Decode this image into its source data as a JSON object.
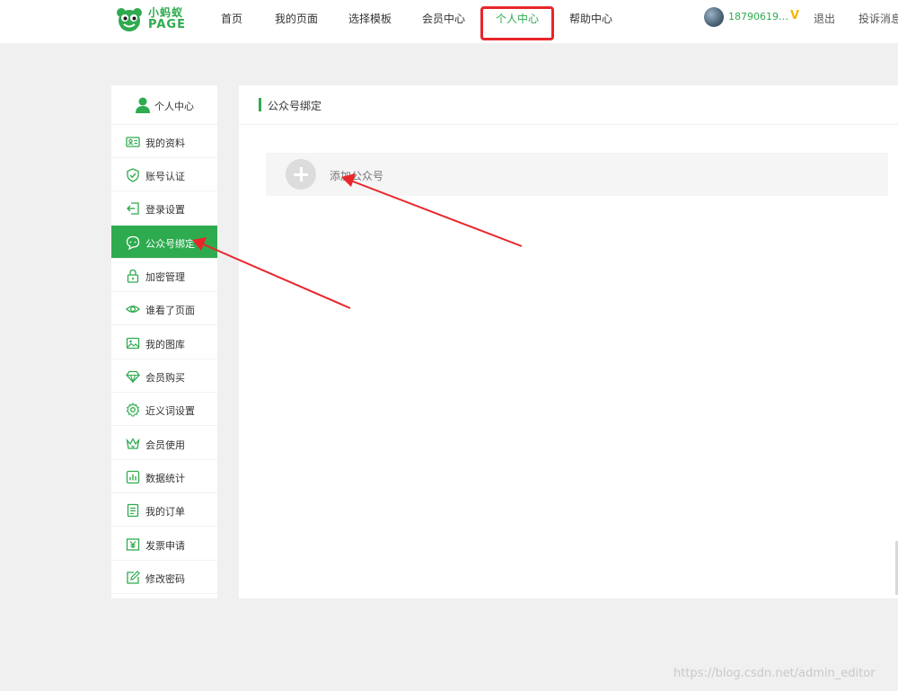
{
  "brand": {
    "name_cn": "小蚂蚁",
    "name_en": "PAGE",
    "color": "#2eab4f"
  },
  "nav": {
    "items": [
      {
        "label": "首页"
      },
      {
        "label": "我的页面"
      },
      {
        "label": "选择模板"
      },
      {
        "label": "会员中心"
      },
      {
        "label": "个人中心",
        "active": true
      },
      {
        "label": "帮助中心"
      }
    ]
  },
  "user": {
    "phone": "18790619…",
    "vip_badge": "V",
    "logout": "退出",
    "complain": "投诉消息"
  },
  "sidebar": {
    "header": "个人中心",
    "items": [
      {
        "label": "我的资料",
        "icon": "id-card-icon"
      },
      {
        "label": "账号认证",
        "icon": "shield-check-icon"
      },
      {
        "label": "登录设置",
        "icon": "login-icon"
      },
      {
        "label": "公众号绑定",
        "icon": "chat-bubble-icon",
        "active": true
      },
      {
        "label": "加密管理",
        "icon": "lock-icon"
      },
      {
        "label": "谁看了页面",
        "icon": "eye-icon"
      },
      {
        "label": "我的图库",
        "icon": "image-icon"
      },
      {
        "label": "会员购买",
        "icon": "diamond-icon"
      },
      {
        "label": "近义词设置",
        "icon": "gear-icon"
      },
      {
        "label": "会员使用",
        "icon": "crown-icon"
      },
      {
        "label": "数据统计",
        "icon": "bar-chart-icon"
      },
      {
        "label": "我的订单",
        "icon": "document-icon"
      },
      {
        "label": "发票申请",
        "icon": "yen-icon"
      },
      {
        "label": "修改密码",
        "icon": "edit-icon"
      }
    ]
  },
  "main": {
    "title": "公众号绑定",
    "add_label": "添加公众号"
  },
  "watermark": "https://blog.csdn.net/admin_editor",
  "colors": {
    "accent": "#2eab4f",
    "annotation_red": "#e8262a",
    "page_bg": "#f0f0f0"
  }
}
